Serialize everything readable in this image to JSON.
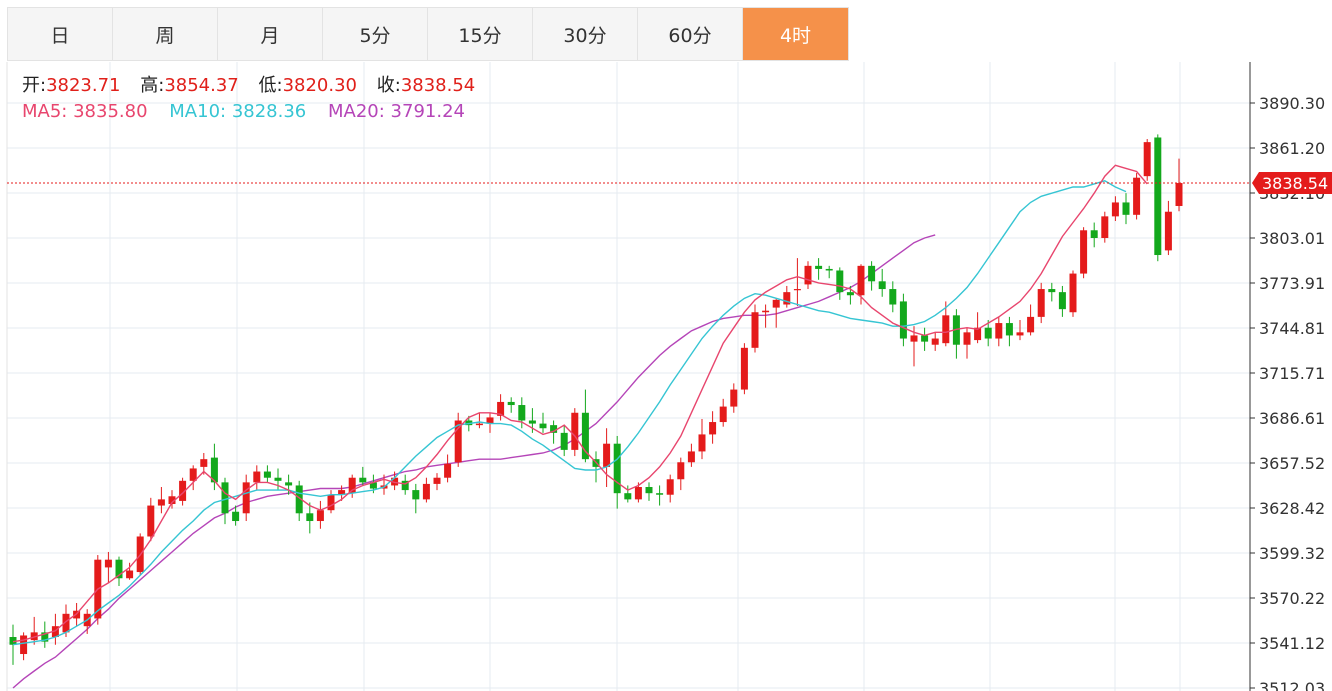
{
  "tabs": [
    {
      "label": "日",
      "active": false
    },
    {
      "label": "周",
      "active": false
    },
    {
      "label": "月",
      "active": false
    },
    {
      "label": "5分",
      "active": false
    },
    {
      "label": "15分",
      "active": false
    },
    {
      "label": "30分",
      "active": false
    },
    {
      "label": "60分",
      "active": false
    },
    {
      "label": "4时",
      "active": true
    }
  ],
  "info": {
    "open_label": "开:",
    "open": "3823.71",
    "high_label": "高:",
    "high": "3854.37",
    "low_label": "低:",
    "low": "3820.30",
    "close_label": "收:",
    "close": "3838.54",
    "ma5_label": "MA5:",
    "ma5": "3835.80",
    "ma10_label": "MA10:",
    "ma10": "3828.36",
    "ma20_label": "MA20:",
    "ma20": "3791.24"
  },
  "colors": {
    "up": "#e41b1b",
    "down": "#13a81c",
    "ma5": "#e8466e",
    "ma10": "#36c5d3",
    "ma20": "#b545b8",
    "tab_active": "#f5914a",
    "price_line": "#e41b1b"
  },
  "chart_data": {
    "type": "candlestick",
    "ylim": [
      3512.03,
      3890.3
    ],
    "yticks": [
      "3890.30",
      "3861.20",
      "3832.10",
      "3803.01",
      "3773.91",
      "3744.81",
      "3715.71",
      "3686.61",
      "3657.52",
      "3628.42",
      "3599.32",
      "3570.22",
      "3541.12",
      "3512.03"
    ],
    "current_price": "3838.54",
    "grid": true,
    "candles": [
      [
        3545,
        3540,
        3553,
        3527
      ],
      [
        3534,
        3546,
        3548,
        3530
      ],
      [
        3543,
        3548,
        3558,
        3540
      ],
      [
        3548,
        3542,
        3555,
        3538
      ],
      [
        3545,
        3552,
        3560,
        3540
      ],
      [
        3548,
        3560,
        3566,
        3545
      ],
      [
        3557,
        3562,
        3567,
        3552
      ],
      [
        3552,
        3560,
        3563,
        3547
      ],
      [
        3557,
        3595,
        3598,
        3553
      ],
      [
        3590,
        3595,
        3600,
        3580
      ],
      [
        3595,
        3583,
        3597,
        3578
      ],
      [
        3583,
        3588,
        3593,
        3582
      ],
      [
        3587,
        3610,
        3612,
        3585
      ],
      [
        3610,
        3630,
        3635,
        3607
      ],
      [
        3630,
        3634,
        3642,
        3625
      ],
      [
        3631,
        3636,
        3640,
        3628
      ],
      [
        3633,
        3646,
        3648,
        3630
      ],
      [
        3646,
        3654,
        3656,
        3640
      ],
      [
        3655,
        3660,
        3664,
        3650
      ],
      [
        3661,
        3645,
        3670,
        3640
      ],
      [
        3645,
        3625,
        3648,
        3618
      ],
      [
        3626,
        3620,
        3630,
        3617
      ],
      [
        3625,
        3645,
        3650,
        3620
      ],
      [
        3645,
        3652,
        3656,
        3640
      ],
      [
        3652,
        3648,
        3656,
        3645
      ],
      [
        3648,
        3646,
        3654,
        3640
      ],
      [
        3645,
        3643,
        3650,
        3637
      ],
      [
        3643,
        3625,
        3646,
        3620
      ],
      [
        3625,
        3620,
        3632,
        3612
      ],
      [
        3620,
        3627,
        3633,
        3615
      ],
      [
        3627,
        3637,
        3640,
        3625
      ],
      [
        3637,
        3640,
        3643,
        3633
      ],
      [
        3638,
        3648,
        3650,
        3635
      ],
      [
        3648,
        3645,
        3655,
        3643
      ],
      [
        3645,
        3641,
        3650,
        3638
      ],
      [
        3641,
        3643,
        3650,
        3637
      ],
      [
        3643,
        3648,
        3652,
        3640
      ],
      [
        3646,
        3640,
        3650,
        3637
      ],
      [
        3640,
        3634,
        3644,
        3625
      ],
      [
        3634,
        3644,
        3648,
        3632
      ],
      [
        3644,
        3648,
        3651,
        3640
      ],
      [
        3648,
        3657,
        3663,
        3645
      ],
      [
        3658,
        3685,
        3690,
        3655
      ],
      [
        3685,
        3682,
        3688,
        3678
      ],
      [
        3682,
        3683,
        3690,
        3680
      ],
      [
        3683,
        3687,
        3690,
        3677
      ],
      [
        3688,
        3697,
        3702,
        3685
      ],
      [
        3697,
        3695,
        3700,
        3690
      ],
      [
        3695,
        3685,
        3700,
        3680
      ],
      [
        3685,
        3683,
        3693,
        3677
      ],
      [
        3683,
        3680,
        3690,
        3677
      ],
      [
        3682,
        3677,
        3685,
        3670
      ],
      [
        3677,
        3666,
        3682,
        3662
      ],
      [
        3666,
        3690,
        3693,
        3662
      ],
      [
        3690,
        3660,
        3705,
        3658
      ],
      [
        3660,
        3655,
        3665,
        3645
      ],
      [
        3655,
        3670,
        3680,
        3642
      ],
      [
        3670,
        3638,
        3675,
        3628
      ],
      [
        3638,
        3634,
        3643,
        3632
      ],
      [
        3634,
        3642,
        3645,
        3632
      ],
      [
        3642,
        3638,
        3645,
        3633
      ],
      [
        3638,
        3637,
        3643,
        3630
      ],
      [
        3637,
        3647,
        3650,
        3632
      ],
      [
        3647,
        3658,
        3661,
        3640
      ],
      [
        3658,
        3665,
        3670,
        3655
      ],
      [
        3665,
        3676,
        3686,
        3660
      ],
      [
        3676,
        3684,
        3691,
        3670
      ],
      [
        3684,
        3694,
        3699,
        3681
      ],
      [
        3694,
        3705,
        3709,
        3690
      ],
      [
        3705,
        3732,
        3735,
        3702
      ],
      [
        3732,
        3755,
        3760,
        3729
      ],
      [
        3755,
        3756,
        3760,
        3745
      ],
      [
        3758,
        3763,
        3764,
        3745
      ],
      [
        3760,
        3768,
        3772,
        3758
      ],
      [
        3770,
        3770,
        3790,
        3759
      ],
      [
        3773,
        3785,
        3788,
        3770
      ],
      [
        3785,
        3783,
        3790,
        3776
      ],
      [
        3783,
        3782,
        3785,
        3777
      ],
      [
        3782,
        3768,
        3784,
        3763
      ],
      [
        3768,
        3766,
        3772,
        3760
      ],
      [
        3766,
        3785,
        3786,
        3760
      ],
      [
        3785,
        3775,
        3788,
        3769
      ],
      [
        3775,
        3770,
        3783,
        3765
      ],
      [
        3770,
        3760,
        3775,
        3755
      ],
      [
        3762,
        3738,
        3767,
        3733
      ],
      [
        3736,
        3740,
        3746,
        3720
      ],
      [
        3740,
        3736,
        3745,
        3730
      ],
      [
        3734,
        3738,
        3742,
        3730
      ],
      [
        3735,
        3753,
        3762,
        3733
      ],
      [
        3753,
        3734,
        3757,
        3725
      ],
      [
        3734,
        3742,
        3745,
        3725
      ],
      [
        3737,
        3745,
        3755,
        3735
      ],
      [
        3745,
        3738,
        3750,
        3733
      ],
      [
        3738,
        3748,
        3752,
        3733
      ],
      [
        3748,
        3740,
        3752,
        3733
      ],
      [
        3740,
        3742,
        3750,
        3737
      ],
      [
        3742,
        3752,
        3760,
        3740
      ],
      [
        3752,
        3770,
        3774,
        3748
      ],
      [
        3770,
        3768,
        3774,
        3762
      ],
      [
        3768,
        3757,
        3772,
        3752
      ],
      [
        3755,
        3780,
        3782,
        3752
      ],
      [
        3780,
        3808,
        3810,
        3777
      ],
      [
        3808,
        3803,
        3813,
        3797
      ],
      [
        3803,
        3817,
        3820,
        3800
      ],
      [
        3817,
        3826,
        3830,
        3814
      ],
      [
        3826,
        3818,
        3832,
        3812
      ],
      [
        3818,
        3842,
        3845,
        3815
      ],
      [
        3843,
        3865,
        3867,
        3840
      ],
      [
        3868,
        3792,
        3870,
        3788
      ],
      [
        3795,
        3820,
        3827,
        3792
      ],
      [
        3823.71,
        3838.54,
        3854.37,
        3820.3
      ]
    ],
    "ma5": [
      3542,
      3543,
      3545,
      3547,
      3549,
      3555,
      3560,
      3568,
      3576,
      3580,
      3585,
      3590,
      3598,
      3608,
      3620,
      3632,
      3638,
      3645,
      3652,
      3646,
      3638,
      3634,
      3640,
      3645,
      3645,
      3643,
      3640,
      3635,
      3630,
      3627,
      3630,
      3634,
      3640,
      3643,
      3645,
      3647,
      3645,
      3644,
      3648,
      3655,
      3663,
      3672,
      3680,
      3687,
      3690,
      3690,
      3689,
      3685,
      3684,
      3680,
      3676,
      3678,
      3682,
      3675,
      3665,
      3658,
      3650,
      3645,
      3640,
      3643,
      3648,
      3655,
      3664,
      3675,
      3690,
      3705,
      3720,
      3735,
      3745,
      3755,
      3763,
      3768,
      3772,
      3776,
      3778,
      3776,
      3774,
      3773,
      3772,
      3770,
      3765,
      3758,
      3753,
      3748,
      3745,
      3742,
      3740,
      3742,
      3742,
      3744,
      3745,
      3744,
      3748,
      3752,
      3757,
      3762,
      3770,
      3780,
      3792,
      3804,
      3813,
      3822,
      3832,
      3843,
      3850,
      3848,
      3846,
      3838
    ],
    "ma10": [
      3540,
      3541,
      3542,
      3543,
      3545,
      3548,
      3552,
      3556,
      3562,
      3567,
      3572,
      3578,
      3585,
      3592,
      3600,
      3607,
      3614,
      3620,
      3627,
      3632,
      3634,
      3636,
      3638,
      3640,
      3640,
      3640,
      3640,
      3638,
      3637,
      3636,
      3637,
      3637,
      3638,
      3639,
      3640,
      3642,
      3648,
      3655,
      3662,
      3668,
      3674,
      3678,
      3682,
      3683,
      3684,
      3683,
      3683,
      3682,
      3678,
      3673,
      3669,
      3664,
      3659,
      3654,
      3653,
      3653,
      3655,
      3660,
      3668,
      3677,
      3687,
      3697,
      3708,
      3718,
      3728,
      3738,
      3746,
      3753,
      3759,
      3764,
      3767,
      3766,
      3764,
      3762,
      3760,
      3758,
      3756,
      3755,
      3753,
      3751,
      3750,
      3749,
      3748,
      3746,
      3746,
      3747,
      3749,
      3753,
      3758,
      3764,
      3771,
      3780,
      3790,
      3800,
      3810,
      3820,
      3826,
      3830,
      3832,
      3834,
      3836,
      3836,
      3838,
      3840,
      3836,
      3833
    ],
    "ma20": [
      3512,
      3518,
      3523,
      3528,
      3532,
      3538,
      3544,
      3550,
      3557,
      3563,
      3570,
      3576,
      3582,
      3588,
      3594,
      3600,
      3606,
      3612,
      3617,
      3622,
      3625,
      3629,
      3632,
      3634,
      3636,
      3637,
      3638,
      3639,
      3640,
      3641,
      3641,
      3641,
      3642,
      3644,
      3646,
      3648,
      3650,
      3652,
      3653,
      3655,
      3656,
      3657,
      3658,
      3659,
      3660,
      3660,
      3660,
      3661,
      3662,
      3663,
      3664,
      3666,
      3669,
      3673,
      3678,
      3683,
      3690,
      3697,
      3705,
      3713,
      3720,
      3727,
      3733,
      3738,
      3743,
      3746,
      3749,
      3751,
      3752,
      3753,
      3753,
      3753,
      3754,
      3756,
      3758,
      3760,
      3762,
      3765,
      3768,
      3771,
      3775,
      3780,
      3785,
      3790,
      3795,
      3800,
      3803,
      3805
    ]
  }
}
